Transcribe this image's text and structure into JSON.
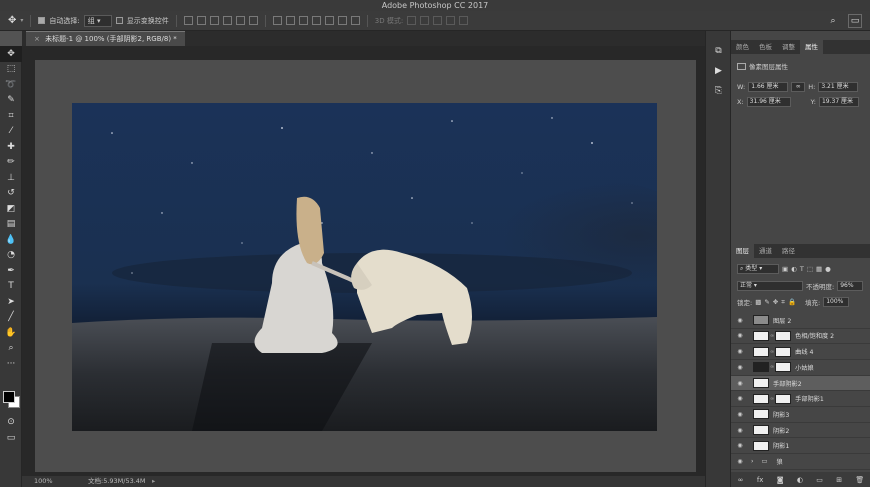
{
  "window": {
    "title": "Adobe Photoshop CC 2017"
  },
  "options_bar": {
    "auto_select_label": "自动选择:",
    "auto_select_value": "组",
    "show_transform_label": "显示变换控件",
    "mode_3d_label": "3D 模式:"
  },
  "document": {
    "tab_title": "未标题-1 @ 100% (手部阴影2, RGB/8) *",
    "zoom": "100%",
    "doc_info": "文档:5.93M/53.4M"
  },
  "properties_panel": {
    "tabs": [
      "颜色",
      "色板",
      "调整",
      "属性"
    ],
    "active_tab": "属性",
    "header": "像素图层属性",
    "w_label": "W:",
    "w_value": "1.66 厘米",
    "h_label": "H:",
    "h_value": "3.21 厘米",
    "x_label": "X:",
    "x_value": "31.96 厘米",
    "y_label": "Y:",
    "y_value": "19.37 厘米"
  },
  "layers_panel": {
    "tabs": [
      "图层",
      "通道",
      "路径"
    ],
    "active_tab": "图层",
    "filter_label": "类型",
    "blend_mode": "正常",
    "opacity_label": "不透明度:",
    "opacity_value": "96%",
    "lock_label": "锁定:",
    "fill_label": "填充:",
    "fill_value": "100%",
    "layers": [
      {
        "name": "图层 2",
        "thumb": "gray",
        "mask": false,
        "selected": false
      },
      {
        "name": "色相/饱和度 2",
        "thumb": "white",
        "mask": true,
        "selected": false
      },
      {
        "name": "曲线 4",
        "thumb": "white",
        "mask": true,
        "selected": false
      },
      {
        "name": "小姑娘",
        "thumb": "dark",
        "mask": true,
        "selected": false
      },
      {
        "name": "手部阴影2",
        "thumb": "white",
        "mask": false,
        "selected": true
      },
      {
        "name": "手部阴影1",
        "thumb": "white",
        "mask": true,
        "selected": false
      },
      {
        "name": "阴影3",
        "thumb": "white",
        "mask": false,
        "selected": false
      },
      {
        "name": "阴影2",
        "thumb": "white",
        "mask": false,
        "selected": false
      },
      {
        "name": "阴影1",
        "thumb": "white",
        "mask": false,
        "selected": false
      },
      {
        "name": "狼",
        "thumb": "folder",
        "mask": false,
        "selected": false
      }
    ],
    "footer_icons": [
      "link-icon",
      "fx-icon",
      "mask-icon",
      "adjustment-icon",
      "folder-icon",
      "new-layer-icon",
      "trash-icon"
    ]
  },
  "tools": [
    "move-tool-icon",
    "marquee-tool-icon",
    "lasso-tool-icon",
    "quick-select-tool-icon",
    "crop-tool-icon",
    "eyedropper-tool-icon",
    "healing-brush-icon",
    "brush-tool-icon",
    "stamp-tool-icon",
    "history-brush-icon",
    "eraser-tool-icon",
    "gradient-tool-icon",
    "blur-tool-icon",
    "dodge-tool-icon",
    "pen-tool-icon",
    "type-tool-icon",
    "path-select-icon",
    "line-tool-icon",
    "hand-tool-icon",
    "zoom-tool-icon",
    "more-tools-icon"
  ],
  "colors": {
    "foreground": "#000000",
    "background": "#ffffff",
    "ui_dark": "#383838",
    "canvas_bg": "#282828"
  }
}
